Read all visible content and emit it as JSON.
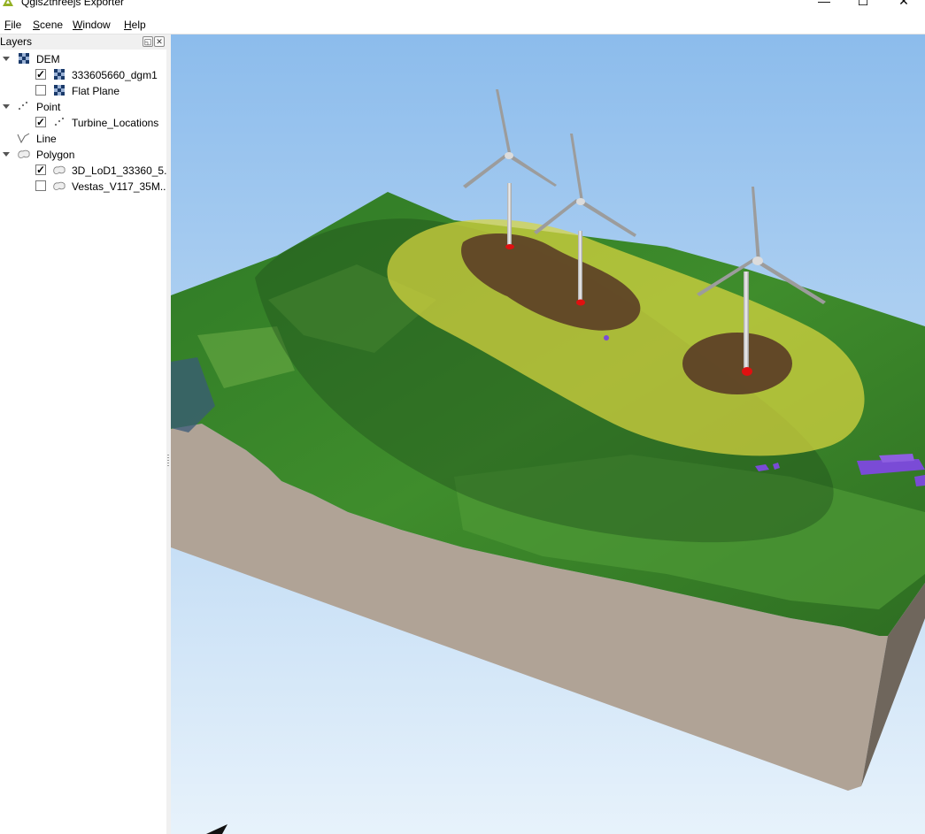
{
  "window": {
    "title": "Qgis2threejs Exporter",
    "minimize": "—",
    "maximize": "☐",
    "close": "✕"
  },
  "menu": {
    "items": [
      {
        "key": "F",
        "rest": "ile"
      },
      {
        "key": "S",
        "rest": "cene"
      },
      {
        "key": "W",
        "rest": "indow"
      },
      {
        "key": "H",
        "rest": "elp"
      }
    ]
  },
  "layers_panel": {
    "title": "Layers",
    "float_glyph": "◱",
    "close_glyph": "✕",
    "groups": {
      "dem": {
        "label": "DEM",
        "items": [
          {
            "label": "333605660_dgm1",
            "checked": "✓"
          },
          {
            "label": "Flat Plane",
            "checked": ""
          }
        ]
      },
      "point": {
        "label": "Point",
        "items": [
          {
            "label": "Turbine_Locations",
            "checked": "✓"
          }
        ]
      },
      "line": {
        "label": "Line"
      },
      "polygon": {
        "label": "Polygon",
        "items": [
          {
            "label": "3D_LoD1_33360_5...",
            "checked": "✓"
          },
          {
            "label": "Vestas_V117_35M...",
            "checked": ""
          }
        ]
      }
    }
  },
  "scene": {
    "sky_top": "#8cbcec",
    "sky_bottom": "#e7f2fb",
    "terrain_side": "#b0a396",
    "terrain_side_dark": "#6f665c",
    "vegetation": "#3d8a2b",
    "buffer_zone": "#d9d540",
    "turbine_pads": "#5b3e26",
    "turbine_marker": "#e01010",
    "buildings": "#7a4bd6",
    "turbine_count": 3
  }
}
